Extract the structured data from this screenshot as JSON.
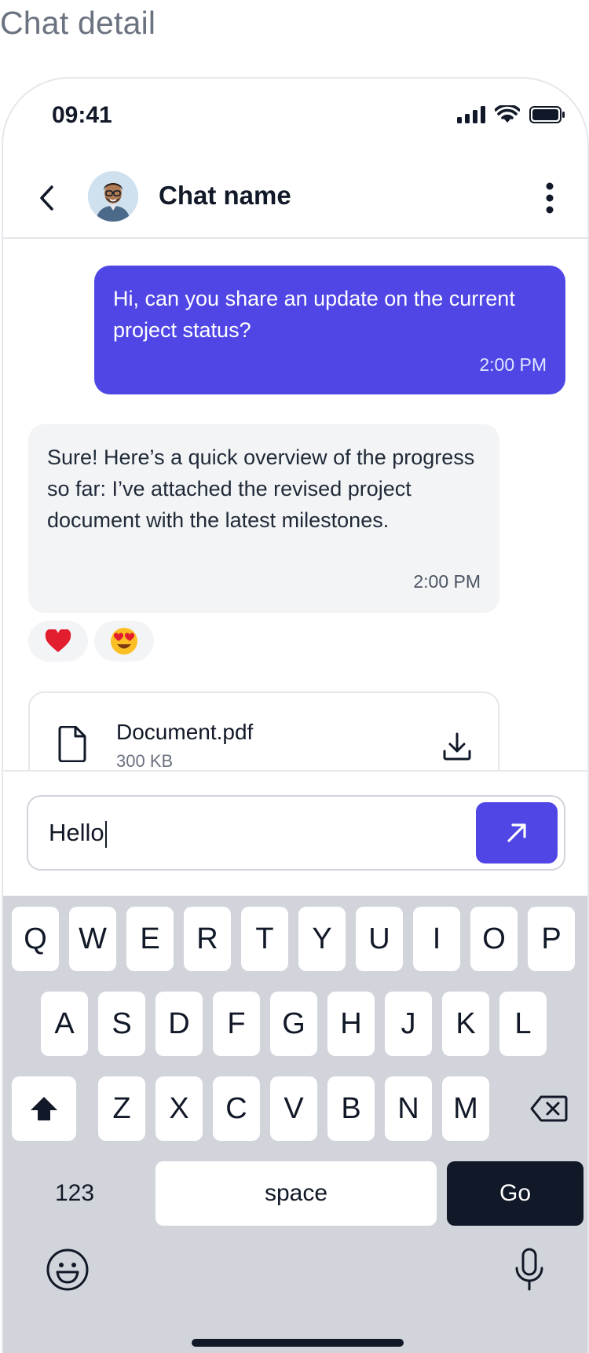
{
  "page_label": "Chat detail",
  "status_bar": {
    "time": "09:41"
  },
  "header": {
    "chat_name": "Chat name"
  },
  "messages": {
    "outgoing": {
      "text": "Hi, can you share an update on the current project status?",
      "time": "2:00 PM"
    },
    "incoming": {
      "text": "Sure! Here’s a quick overview of the progress so far: I’ve attached the revised project document with the latest milestones.",
      "time": "2:00 PM"
    },
    "reactions": [
      {
        "emoji": "heart"
      },
      {
        "emoji": "heart-eyes"
      }
    ],
    "attachment": {
      "file_name": "Document.pdf",
      "file_size": "300 KB"
    }
  },
  "composer": {
    "value": "Hello"
  },
  "keyboard": {
    "row1": [
      "Q",
      "W",
      "E",
      "R",
      "T",
      "Y",
      "U",
      "I",
      "O",
      "P"
    ],
    "row2": [
      "A",
      "S",
      "D",
      "F",
      "G",
      "H",
      "J",
      "K",
      "L"
    ],
    "row3": [
      "Z",
      "X",
      "C",
      "V",
      "B",
      "N",
      "M"
    ],
    "numbers_label": "123",
    "space_label": "space",
    "go_label": "Go"
  },
  "colors": {
    "accent": "#4f46e5",
    "incoming_bubble": "#f3f4f6",
    "keyboard_bg": "#d1d5db",
    "go_key": "#111827"
  }
}
